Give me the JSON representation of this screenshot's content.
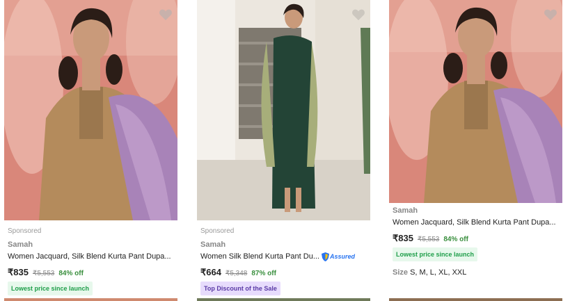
{
  "products": [
    {
      "sponsored": "Sponsored",
      "brand": "Samah",
      "title": "Women Jacquard, Silk Blend Kurta Pant Dupa...",
      "price": "₹835",
      "mrp": "₹5,553",
      "discount": "84% off",
      "badge": "Lowest price since launch",
      "badge_color": "#1f9e4a"
    },
    {
      "sponsored": "Sponsored",
      "brand": "Samah",
      "title": "Women Silk Blend Kurta Pant Du...",
      "assured": "Assured",
      "price": "₹664",
      "mrp": "₹5,348",
      "discount": "87% off",
      "badge": "Top Discount of the Sale",
      "badge_color": "#5a3aa6"
    },
    {
      "brand": "Samah",
      "title": "Women Jacquard, Silk Blend Kurta Pant Dupa...",
      "price": "₹835",
      "mrp": "₹5,553",
      "discount": "84% off",
      "badge": "Lowest price since launch",
      "badge_color": "#1f9e4a",
      "sizes_label": "Size",
      "sizes": "S, M, L, XL, XXL"
    }
  ],
  "icons": {
    "wishlist": "heart-icon",
    "assured": "assured-shield-icon"
  },
  "colors": {
    "discount": "#388e3c",
    "assured": "#2874f0"
  }
}
